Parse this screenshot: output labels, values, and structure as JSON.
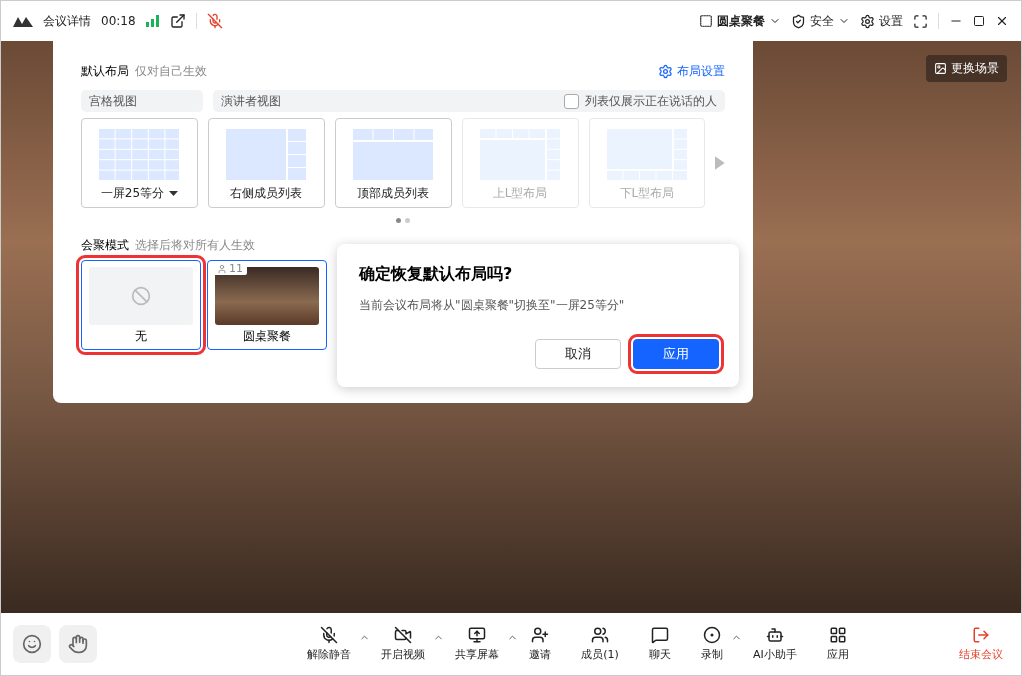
{
  "topbar": {
    "title": "会议详情",
    "timer": "00:18",
    "layout_menu": "圆桌聚餐",
    "security": "安全",
    "settings": "设置"
  },
  "scene_button": "更换场景",
  "layout_panel": {
    "title": "默认布局",
    "subtitle": "仅对自己生效",
    "settings_link": "布局设置",
    "groups": [
      {
        "label": "宫格视图"
      },
      {
        "label": "演讲者视图",
        "checkbox": {
          "label": "列表仅展示正在说话的人",
          "checked": false
        }
      }
    ],
    "layouts": [
      {
        "kind": "grid",
        "label": "一屏25等分",
        "dropdown": true,
        "disabled": false
      },
      {
        "kind": "right",
        "label": "右侧成员列表",
        "dropdown": false,
        "disabled": false
      },
      {
        "kind": "top",
        "label": "顶部成员列表",
        "dropdown": false,
        "disabled": false
      },
      {
        "kind": "topl",
        "label": "上L型布局",
        "dropdown": false,
        "disabled": true
      },
      {
        "kind": "bottoml",
        "label": "下L型布局",
        "dropdown": false,
        "disabled": true
      }
    ],
    "pages": [
      {
        "selected": true
      },
      {
        "selected": false
      }
    ],
    "mode_title": "会聚模式",
    "mode_subtitle": "选择后将对所有人生效",
    "modes": [
      {
        "kind": "none",
        "label": "无",
        "selected": true,
        "highlighted": true
      },
      {
        "kind": "scene",
        "label": "圆桌聚餐",
        "count": "11",
        "selected": true,
        "highlighted": false
      }
    ]
  },
  "dialog": {
    "title": "确定恢复默认布局吗?",
    "message": "当前会议布局将从\"圆桌聚餐\"切换至\"一屏25等分\"",
    "buttons": [
      {
        "kind": "secondary",
        "label": "取消",
        "highlighted": false
      },
      {
        "kind": "primary",
        "label": "应用",
        "highlighted": true
      }
    ]
  },
  "toolbar": [
    {
      "kind": "mic",
      "label": "解除静音",
      "caret": true
    },
    {
      "kind": "video",
      "label": "开启视频",
      "caret": true
    },
    {
      "kind": "share",
      "label": "共享屏幕",
      "caret": true
    },
    {
      "kind": "invite",
      "label": "邀请",
      "caret": false
    },
    {
      "kind": "members",
      "label": "成员(1)",
      "caret": false
    },
    {
      "kind": "chat",
      "label": "聊天",
      "caret": false
    },
    {
      "kind": "record",
      "label": "录制",
      "caret": true
    },
    {
      "kind": "ai",
      "label": "AI小助手",
      "caret": false
    },
    {
      "kind": "apps",
      "label": "应用",
      "caret": false
    }
  ],
  "end_button": "结束会议"
}
